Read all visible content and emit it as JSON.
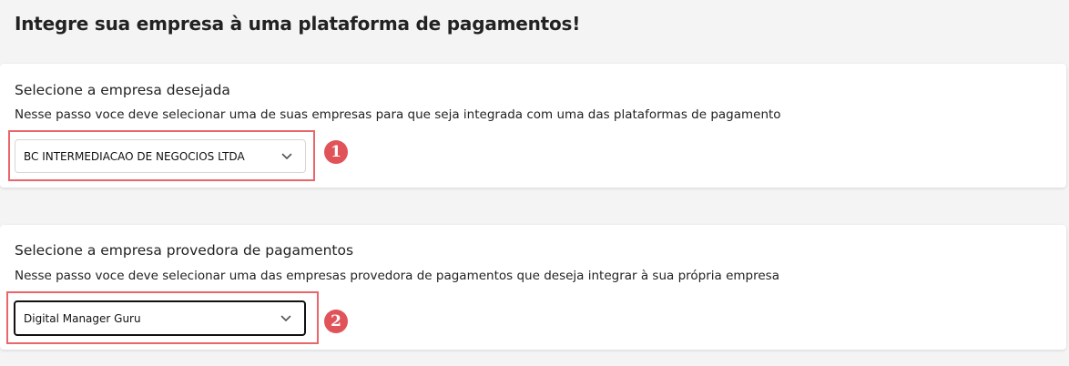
{
  "page": {
    "title": "Integre sua empresa à uma plataforma de pagamentos!"
  },
  "company_section": {
    "heading": "Selecione a empresa desejada",
    "description": "Nesse passo voce deve selecionar uma de suas empresas para que seja integrada com uma das plataformas de pagamento",
    "selected_value": "BC INTERMEDIACAO DE NEGOCIOS LTDA",
    "callout_number": "1",
    "icon": "chevron-down-icon"
  },
  "provider_section": {
    "heading": "Selecione a empresa provedora de pagamentos",
    "description": "Nesse passo voce deve selecionar uma das empresas provedora de pagamentos que deseja integrar à sua própria empresa",
    "selected_value": "Digital Manager Guru",
    "callout_number": "2",
    "icon": "chevron-down-icon"
  },
  "colors": {
    "background": "#f4f4f4",
    "card": "#ffffff",
    "highlight": "#e9666a",
    "badge": "#e05359"
  }
}
